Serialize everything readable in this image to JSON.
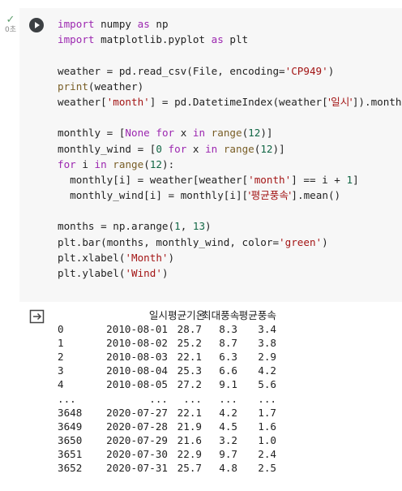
{
  "cell": {
    "run_time": "0초",
    "code_lines": [
      "import numpy as np",
      "import matplotlib.pyplot as plt",
      "",
      "weather = pd.read_csv(File, encoding='CP949')",
      "print(weather)",
      "weather['month'] = pd.DatetimeIndex(weather['일시']).month",
      "",
      "monthly = [None for x in range(12)]",
      "monthly_wind = [0 for x in range(12)]",
      "for i in range(12):",
      "  monthly[i] = weather[weather['month'] == i + 1]",
      "  monthly_wind[i] = monthly[i]['평균풍속'].mean()",
      "",
      "months = np.arange(1, 13)",
      "plt.bar(months, monthly_wind, color='green')",
      "plt.xlabel('Month')",
      "plt.ylabel('Wind')"
    ]
  },
  "output": {
    "columns": [
      "",
      "일시",
      "평균기온",
      "최대풍속",
      "평균풍속"
    ],
    "rows": [
      [
        "0",
        "2010-08-01",
        "28.7",
        "8.3",
        "3.4"
      ],
      [
        "1",
        "2010-08-02",
        "25.2",
        "8.7",
        "3.8"
      ],
      [
        "2",
        "2010-08-03",
        "22.1",
        "6.3",
        "2.9"
      ],
      [
        "3",
        "2010-08-04",
        "25.3",
        "6.6",
        "4.2"
      ],
      [
        "4",
        "2010-08-05",
        "27.2",
        "9.1",
        "5.6"
      ],
      [
        "...",
        "...",
        "...",
        "...",
        "..."
      ],
      [
        "3648",
        "2020-07-27",
        "22.1",
        "4.2",
        "1.7"
      ],
      [
        "3649",
        "2020-07-28",
        "21.9",
        "4.5",
        "1.6"
      ],
      [
        "3650",
        "2020-07-29",
        "21.6",
        "3.2",
        "1.0"
      ],
      [
        "3651",
        "2020-07-30",
        "22.9",
        "9.7",
        "2.4"
      ],
      [
        "3652",
        "2020-07-31",
        "25.7",
        "4.8",
        "2.5"
      ]
    ]
  },
  "icons": {
    "status": "check-icon",
    "run": "play-icon",
    "output": "output-redirect-icon"
  },
  "colors": {
    "keyword": "#9c27b0",
    "string": "#a31515",
    "number": "#116644",
    "status_ok": "#5f9e6e"
  }
}
